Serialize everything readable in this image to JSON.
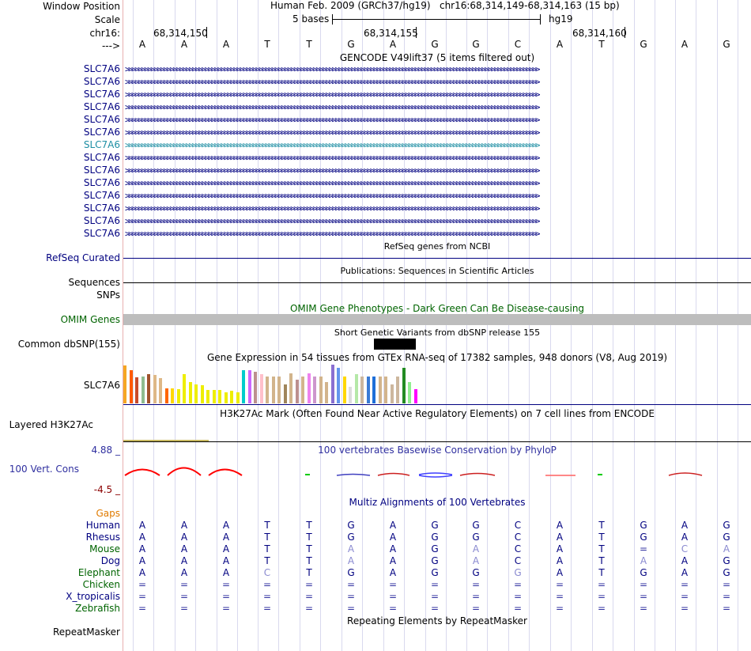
{
  "header": {
    "window_position_label": "Window Position",
    "assembly": "Human Feb. 2009 (GRCh37/hg19)",
    "position": "chr16:68,314,149-68,314,163 (15 bp)",
    "scale_label": "Scale",
    "scale_text": "5 bases",
    "db": "hg19",
    "chrom_label": "chr16:",
    "strand_label": "--->",
    "coords": [
      "68,314,150",
      "68,314,155",
      "68,314,160"
    ],
    "bases": [
      "A",
      "A",
      "A",
      "T",
      "T",
      "G",
      "A",
      "G",
      "G",
      "C",
      "A",
      "T",
      "G",
      "A",
      "G"
    ]
  },
  "gencode": {
    "title": "GENCODE V49lift37 (5 items filtered out)",
    "gene_labels": [
      "SLC7A6",
      "SLC7A6",
      "SLC7A6",
      "SLC7A6",
      "SLC7A6",
      "SLC7A6",
      "SLC7A6",
      "SLC7A6",
      "SLC7A6",
      "SLC7A6",
      "SLC7A6",
      "SLC7A6",
      "SLC7A6",
      "SLC7A6"
    ],
    "highlight_index": 6,
    "colors": {
      "normal": "#000080",
      "highlight": "#1d8ea3"
    }
  },
  "refseq": {
    "label": "RefSeq Curated",
    "title": "RefSeq genes from NCBI"
  },
  "pubs": {
    "label": "Sequences",
    "title": "Publications: Sequences in Scientific Articles"
  },
  "snps_label": "SNPs",
  "omim": {
    "label": "OMIM Genes",
    "title": "OMIM Gene Phenotypes - Dark Green Can Be Disease-causing",
    "color": "#006400"
  },
  "dbsnp": {
    "label": "Common dbSNP(155)",
    "title": "Short Genetic Variants from dbSNP release 155"
  },
  "gtex": {
    "title": "Gene Expression in 54 tissues from GTEx RNA-seq of 17382 samples, 948 donors (V8, Aug 2019)",
    "label": "SLC7A6",
    "bars": [
      {
        "v": 1.0,
        "c": "#f5a623"
      },
      {
        "v": 0.88,
        "c": "#ff5a00"
      },
      {
        "v": 0.68,
        "c": "#c84b2c"
      },
      {
        "v": 0.7,
        "c": "#8fbc8f"
      },
      {
        "v": 0.78,
        "c": "#a0522d"
      },
      {
        "v": 0.74,
        "c": "#deb887"
      },
      {
        "v": 0.67,
        "c": "#deb887"
      },
      {
        "v": 0.4,
        "c": "#ff6600"
      },
      {
        "v": 0.4,
        "c": "#ffd700"
      },
      {
        "v": 0.37,
        "c": "#eeee00"
      },
      {
        "v": 0.77,
        "c": "#eeee00"
      },
      {
        "v": 0.57,
        "c": "#eeee00"
      },
      {
        "v": 0.5,
        "c": "#eeee00"
      },
      {
        "v": 0.47,
        "c": "#eeee00"
      },
      {
        "v": 0.36,
        "c": "#eeee00"
      },
      {
        "v": 0.35,
        "c": "#eeee00"
      },
      {
        "v": 0.35,
        "c": "#eeee00"
      },
      {
        "v": 0.3,
        "c": "#eeee00"
      },
      {
        "v": 0.34,
        "c": "#eeee00"
      },
      {
        "v": 0.3,
        "c": "#eeee00"
      },
      {
        "v": 0.87,
        "c": "#00cdcd"
      },
      {
        "v": 0.87,
        "c": "#cc66ff"
      },
      {
        "v": 0.83,
        "c": "#bc8f8f"
      },
      {
        "v": 0.77,
        "c": "#ffc0cb"
      },
      {
        "v": 0.7,
        "c": "#d2b48c"
      },
      {
        "v": 0.7,
        "c": "#d2b48c"
      },
      {
        "v": 0.7,
        "c": "#d2b48c"
      },
      {
        "v": 0.5,
        "c": "#a0855b"
      },
      {
        "v": 0.8,
        "c": "#d2b48c"
      },
      {
        "v": 0.63,
        "c": "#bc8f8f"
      },
      {
        "v": 0.7,
        "c": "#d2b48c"
      },
      {
        "v": 0.8,
        "c": "#ee82ee"
      },
      {
        "v": 0.7,
        "c": "#cd96cd"
      },
      {
        "v": 0.7,
        "c": "#d2b48c"
      },
      {
        "v": 0.57,
        "c": "#d2b48c"
      },
      {
        "v": 1.02,
        "c": "#8a6fd1"
      },
      {
        "v": 0.93,
        "c": "#6495ed"
      },
      {
        "v": 0.7,
        "c": "#ffd700"
      },
      {
        "v": 0.43,
        "c": "#dddddd"
      },
      {
        "v": 0.77,
        "c": "#b5e8a8"
      },
      {
        "v": 0.7,
        "c": "#cdb79e"
      },
      {
        "v": 0.7,
        "c": "#3a7bd5"
      },
      {
        "v": 0.7,
        "c": "#1e6fd9"
      },
      {
        "v": 0.7,
        "c": "#d2b48c"
      },
      {
        "v": 0.7,
        "c": "#d2b48c"
      },
      {
        "v": 0.5,
        "c": "#cdb79e"
      },
      {
        "v": 0.7,
        "c": "#cdb79e"
      },
      {
        "v": 0.93,
        "c": "#228b22"
      },
      {
        "v": 0.57,
        "c": "#90ee90"
      },
      {
        "v": 0.37,
        "c": "#ff00ff"
      }
    ]
  },
  "h3k27ac": {
    "label": "Layered H3K27Ac",
    "title": "H3K27Ac Mark (Often Found Near Active Regulatory Elements) on 7 cell lines from ENCODE"
  },
  "phylop": {
    "label": "100 Vert. Cons",
    "max": "4.88 _",
    "min": "-4.5 _",
    "title": "100 vertebrates Basewise Conservation by PhyloP"
  },
  "multiz": {
    "title": "Multiz Alignments of 100 Vertebrates",
    "gaps_label": "Gaps",
    "species": [
      {
        "name": "Human",
        "color": "#000080",
        "seq": [
          "A",
          "A",
          "A",
          "T",
          "T",
          "G",
          "A",
          "G",
          "G",
          "C",
          "A",
          "T",
          "G",
          "A",
          "G"
        ]
      },
      {
        "name": "Rhesus",
        "color": "#000080",
        "seq": [
          "A",
          "A",
          "A",
          "T",
          "T",
          "G",
          "A",
          "G",
          "G",
          "C",
          "A",
          "T",
          "G",
          "A",
          "G"
        ]
      },
      {
        "name": "Mouse",
        "color": "#006400",
        "seq": [
          "A",
          "A",
          "A",
          "T",
          "T",
          "A",
          "A",
          "G",
          "A",
          "C",
          "A",
          "T",
          "=",
          "C",
          "A"
        ]
      },
      {
        "name": "Dog",
        "color": "#000080",
        "seq": [
          "A",
          "A",
          "A",
          "T",
          "T",
          "A",
          "A",
          "G",
          "A",
          "C",
          "A",
          "T",
          "A",
          "A",
          "G"
        ]
      },
      {
        "name": "Elephant",
        "color": "#006400",
        "seq": [
          "A",
          "A",
          "A",
          "C",
          "T",
          "G",
          "A",
          "G",
          "G",
          "G",
          "A",
          "T",
          "G",
          "A",
          "G"
        ]
      },
      {
        "name": "Chicken",
        "color": "#006400",
        "seq": [
          "=",
          "=",
          "=",
          "=",
          "=",
          "=",
          "=",
          "=",
          "=",
          "=",
          "=",
          "=",
          "=",
          "=",
          "="
        ]
      },
      {
        "name": "X_tropicalis",
        "color": "#000080",
        "seq": [
          "=",
          "=",
          "=",
          "=",
          "=",
          "=",
          "=",
          "=",
          "=",
          "=",
          "=",
          "=",
          "=",
          "=",
          "="
        ]
      },
      {
        "name": "Zebrafish",
        "color": "#006400",
        "seq": [
          "=",
          "=",
          "=",
          "=",
          "=",
          "=",
          "=",
          "=",
          "=",
          "=",
          "=",
          "=",
          "=",
          "=",
          "="
        ]
      }
    ]
  },
  "repeatmasker": {
    "label": "RepeatMasker",
    "title": "Repeating Elements by RepeatMasker"
  }
}
